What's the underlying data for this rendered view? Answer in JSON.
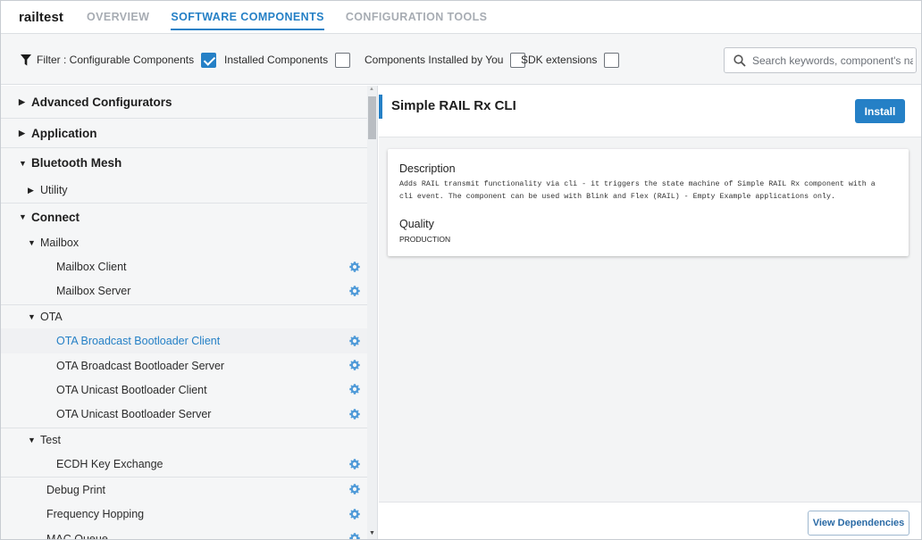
{
  "header": {
    "project": "railtest",
    "tabs": [
      {
        "label": "OVERVIEW",
        "active": false
      },
      {
        "label": "SOFTWARE COMPONENTS",
        "active": true
      },
      {
        "label": "CONFIGURATION TOOLS",
        "active": false
      }
    ]
  },
  "filters": {
    "configurable": {
      "label": "Filter : Configurable Components",
      "checked": true
    },
    "installed": {
      "label": "Installed Components",
      "checked": false
    },
    "installed_by_you": {
      "label": "Components Installed by You",
      "checked": false
    },
    "sdk_extensions": {
      "label": "SDK extensions",
      "checked": false
    },
    "search_placeholder": "Search keywords, component's name"
  },
  "tree": {
    "advanced_configurators": "Advanced Configurators",
    "application": "Application",
    "bluetooth_mesh": "Bluetooth Mesh",
    "utility": "Utility",
    "connect": "Connect",
    "mailbox": "Mailbox",
    "mailbox_client": "Mailbox Client",
    "mailbox_server": "Mailbox Server",
    "ota": "OTA",
    "ota_bcast_client": "OTA Broadcast Bootloader Client",
    "ota_bcast_server": "OTA Broadcast Bootloader Server",
    "ota_ucast_client": "OTA Unicast Bootloader Client",
    "ota_ucast_server": "OTA Unicast Bootloader Server",
    "test": "Test",
    "ecdh": "ECDH Key Exchange",
    "debug_print": "Debug Print",
    "frequency_hopping": "Frequency Hopping",
    "mac_queue": "MAC Queue"
  },
  "detail": {
    "title": "Simple RAIL Rx CLI",
    "install_label": "Install",
    "description_label": "Description",
    "description_line1": "Adds RAIL transmit functionality via cli - it triggers the state machine of Simple RAIL Rx component with a",
    "description_line2": "cli event. The component can be used with Blink and Flex (RAIL) - Empty Example applications only.",
    "quality_label": "Quality",
    "quality_value": "PRODUCTION",
    "view_dependencies_label": "View Dependencies"
  },
  "colors": {
    "accent": "#2580c6",
    "gear": "#4f9ad8",
    "panel_bg": "#f5f6f7"
  }
}
